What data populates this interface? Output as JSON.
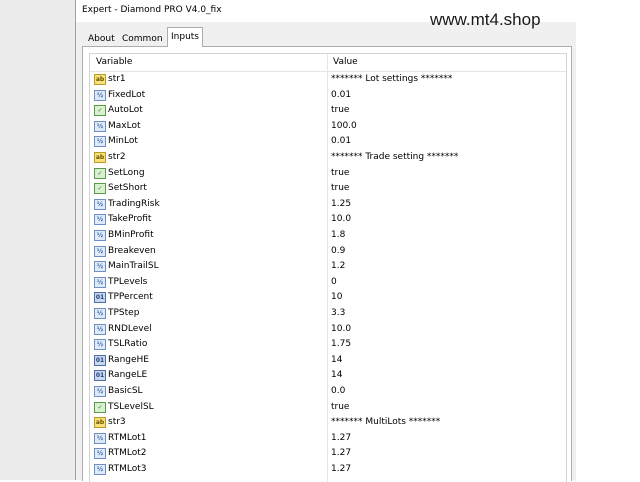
{
  "window": {
    "title": "Expert - Diamond PRO V4.0_fix"
  },
  "watermark": "www.mt4.shop",
  "tabs": [
    {
      "label": "About",
      "active": false
    },
    {
      "label": "Common",
      "active": false
    },
    {
      "label": "Inputs",
      "active": true
    }
  ],
  "grid": {
    "columns": {
      "variable": "Variable",
      "value": "Value"
    },
    "rows": [
      {
        "icon": "abc",
        "name": "str1",
        "value": "******* Lot settings *******"
      },
      {
        "icon": "dbl",
        "name": "FixedLot",
        "value": "0.01"
      },
      {
        "icon": "bool",
        "name": "AutoLot",
        "value": "true"
      },
      {
        "icon": "dbl",
        "name": "MaxLot",
        "value": "100.0"
      },
      {
        "icon": "dbl",
        "name": "MinLot",
        "value": "0.01"
      },
      {
        "icon": "abc",
        "name": "str2",
        "value": "******* Trade setting *******"
      },
      {
        "icon": "bool",
        "name": "SetLong",
        "value": "true"
      },
      {
        "icon": "bool",
        "name": "SetShort",
        "value": "true"
      },
      {
        "icon": "dbl",
        "name": "TradingRisk",
        "value": "1.25"
      },
      {
        "icon": "dbl",
        "name": "TakeProfit",
        "value": "10.0"
      },
      {
        "icon": "dbl",
        "name": "BMinProfit",
        "value": "1.8"
      },
      {
        "icon": "dbl",
        "name": "Breakeven",
        "value": "0.9"
      },
      {
        "icon": "dbl",
        "name": "MainTrailSL",
        "value": "1.2"
      },
      {
        "icon": "dbl",
        "name": "TPLevels",
        "value": "0"
      },
      {
        "icon": "int",
        "name": "TPPercent",
        "value": "10"
      },
      {
        "icon": "dbl",
        "name": "TPStep",
        "value": "3.3"
      },
      {
        "icon": "dbl",
        "name": "RNDLevel",
        "value": "10.0"
      },
      {
        "icon": "dbl",
        "name": "TSLRatio",
        "value": "1.75"
      },
      {
        "icon": "int",
        "name": "RangeHE",
        "value": "14"
      },
      {
        "icon": "int",
        "name": "RangeLE",
        "value": "14"
      },
      {
        "icon": "dbl",
        "name": "BasicSL",
        "value": "0.0"
      },
      {
        "icon": "bool",
        "name": "TSLevelSL",
        "value": "true"
      },
      {
        "icon": "abc",
        "name": "str3",
        "value": "******* MultiLots *******"
      },
      {
        "icon": "dbl",
        "name": "RTMLot1",
        "value": "1.27"
      },
      {
        "icon": "dbl",
        "name": "RTMLot2",
        "value": "1.27"
      },
      {
        "icon": "dbl",
        "name": "RTMLot3",
        "value": "1.27"
      }
    ]
  },
  "icons": {
    "abc": "string-type-icon",
    "dbl": "double-type-icon",
    "int": "integer-type-icon",
    "bool": "bool-type-icon"
  },
  "colors": {
    "accent": "#adadad",
    "string_icon": "#f7e27a",
    "double_icon": "#dfeaf8",
    "integer_icon": "#c9d7ef",
    "bool_icon": "#d8f0d0"
  }
}
